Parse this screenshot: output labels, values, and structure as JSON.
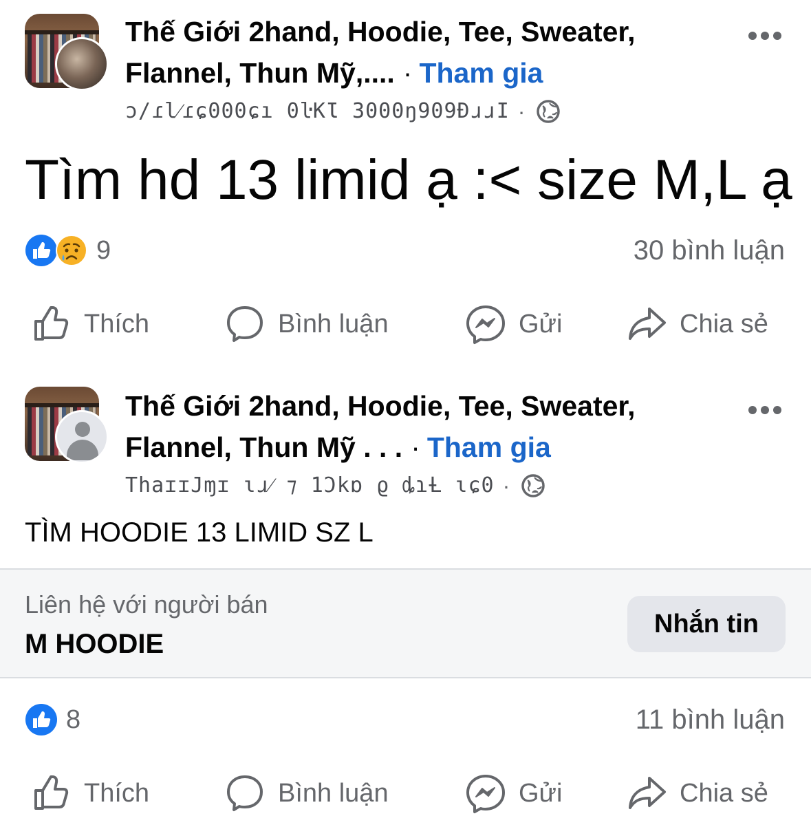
{
  "post1": {
    "group_name": "Thế Giới 2hand, Hoodie, Tee, Sweater, Flannel, Thun Mỹ,....",
    "join_label": "Tham gia",
    "separator": "·",
    "meta_text": "ɔ/ɾl⁄ɾɕ000ɕı 0ŀKƖ 3000ŋ909ƉɹɹI",
    "icons": {
      "more": "more-dots-icon",
      "privacy": "globe-icon"
    },
    "body": "Tìm hd 13 limid ạ :< size M,L ạ",
    "reaction_count": "9",
    "reaction_icons": [
      "like-icon",
      "sad-icon"
    ],
    "comment_count": "30 bình luận"
  },
  "post2": {
    "group_name": "Thế Giới 2hand, Hoodie, Tee, Sweater, Flannel, Thun Mỹ . . .",
    "join_label": "Tham gia",
    "separator": "·",
    "meta_text": "ThaɪɪJɱɪ ɩɹ⁄ ⁊ 1Ɔkɒ ϱ ȡɿȽ ɩɕ0",
    "icons": {
      "more": "more-dots-icon",
      "privacy": "globe-icon"
    },
    "body": "TÌM HOODIE 13 LIMID SZ L",
    "seller": {
      "label": "Liên hệ với người bán",
      "name": "M HOODIE",
      "button_label": "Nhắn tin"
    },
    "reaction_count": "8",
    "reaction_icons": [
      "like-icon"
    ],
    "comment_count": "11 bình luận"
  },
  "actions": {
    "like": "Thích",
    "comment": "Bình luận",
    "send": "Gửi",
    "share": "Chia sẻ"
  },
  "colors": {
    "accent_blue": "#1b66c9",
    "like_blue": "#1877f2",
    "secondary_text": "#65676b",
    "button_bg": "#e4e6eb"
  }
}
